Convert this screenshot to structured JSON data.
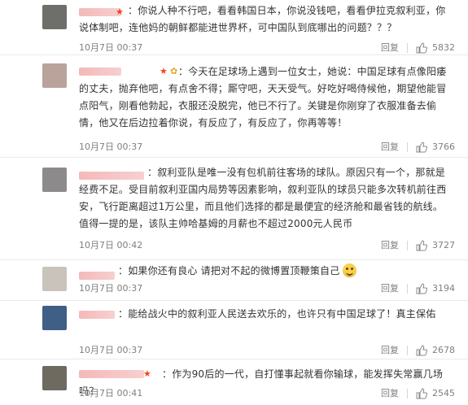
{
  "comments": [
    {
      "text": "：你说人种不行吧，看看韩国日本，你说没钱吧，看看伊拉克叙利亚，你说体制吧，连他妈的朝鲜都能进世界杯，可中国队到底哪出的问题？？？",
      "time": "10月7日 00:37",
      "reply": "回复",
      "likes": "5832",
      "badge": "★",
      "avatar_color": "#6e6f6a"
    },
    {
      "text": "：今天在足球场上遇到一位女士，她说：中国足球有点像阳痿的丈夫，抛弃他吧，有点舍不得；厮守吧，天天受气。好吃好喝侍候他，期望他能冒点阳气，刚看他勃起，衣服还没脱完，他已不行了。关键是你刚穿了衣服准备去偷情，他又在后边拉着你说，有反应了，有反应了，你再等等！",
      "time": "10月7日 00:37",
      "reply": "回复",
      "likes": "3766",
      "badge": "★",
      "extra_badge": "✿",
      "avatar_color": "#b9a39a"
    },
    {
      "text": "：叙利亚队是唯一没有包机前往客场的球队。原因只有一个，那就是经费不足。受目前叙利亚国内局势等因素影响，叙利亚队的球员只能多次转机前往西安，飞行距离超过1万公里，而且他们选择的都是最便宜的经济舱和最省钱的航线。值得一提的是，该队主帅哈基姆的月薪也不超过2000元人民币",
      "time": "10月7日 00:42",
      "reply": "回复",
      "likes": "3727",
      "avatar_color": "#8d8a8c"
    },
    {
      "text": "：如果你还有良心 请把对不起的微博置顶鞭策自己",
      "time": "10月7日 00:37",
      "reply": "回复",
      "likes": "3194",
      "emoji": "smile-emoji",
      "avatar_color": "#c9c3bc"
    },
    {
      "text": "：能给战火中的叙利亚人民送去欢乐的，也许只有中国足球了！真主保佑",
      "time": "10月7日 00:37",
      "reply": "回复",
      "likes": "2678",
      "avatar_color": "#3f5f86"
    },
    {
      "text": "：作为90后的一代，自打懂事起就看你输球，能发挥失常赢几场吗？",
      "time": "10月7日 00:41",
      "reply": "回复",
      "likes": "2545",
      "badge": "★",
      "avatar_color": "#6f6a5f"
    }
  ]
}
